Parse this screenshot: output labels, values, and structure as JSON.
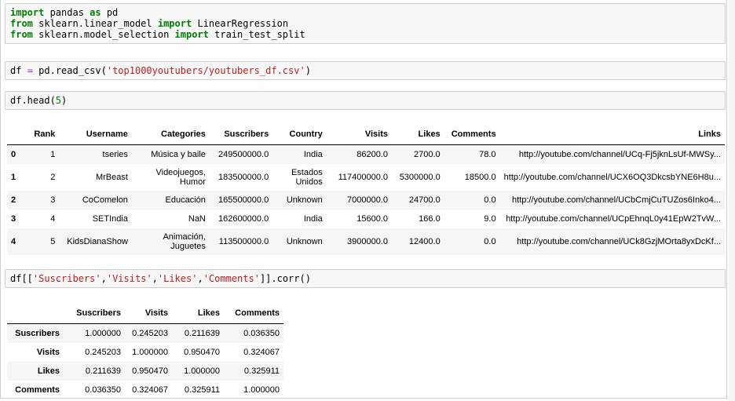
{
  "cells": {
    "c1_l1": {
      "kw1": "import",
      "t1": " pandas ",
      "kw2": "as",
      "t2": " pd"
    },
    "c1_l2": {
      "kw1": "from",
      "t1": " sklearn.linear_model ",
      "kw2": "import",
      "t2": " LinearRegression"
    },
    "c1_l3": {
      "kw1": "from",
      "t1": " sklearn.model_selection ",
      "kw2": "import",
      "t2": " train_test_split"
    },
    "c2": {
      "a": "df ",
      "op": "=",
      "b": " pd.read_csv(",
      "str": "'top1000youtubers/youtubers_df.csv'",
      "c": ")"
    },
    "c3": {
      "a": "df.head(",
      "num": "5",
      "b": ")"
    },
    "c4": {
      "a": "df[[",
      "s1": "'Suscribers'",
      "k1": ",",
      "s2": "'Visits'",
      "k2": ",",
      "s3": "'Likes'",
      "k3": ",",
      "s4": "'Comments'",
      "b": "]].corr()"
    }
  },
  "head_table": {
    "columns": [
      "",
      "Rank",
      "Username",
      "Categories",
      "Suscribers",
      "Country",
      "Visits",
      "Likes",
      "Comments",
      "Links"
    ],
    "rows": [
      [
        "0",
        "1",
        "tseries",
        "Música y baile",
        "249500000.0",
        "India",
        "86200.0",
        "2700.0",
        "78.0",
        "http://youtube.com/channel/UCq-Fj5jknLsUf-MWSy..."
      ],
      [
        "1",
        "2",
        "MrBeast",
        "Videojuegos, Humor",
        "183500000.0",
        "Estados Unidos",
        "117400000.0",
        "5300000.0",
        "18500.0",
        "http://youtube.com/channel/UCX6OQ3DkcsbYNE6H8u..."
      ],
      [
        "2",
        "3",
        "CoComelon",
        "Educación",
        "165500000.0",
        "Unknown",
        "7000000.0",
        "24700.0",
        "0.0",
        "http://youtube.com/channel/UCbCmjCuTUZos6Inko4..."
      ],
      [
        "3",
        "4",
        "SETIndia",
        "NaN",
        "162600000.0",
        "India",
        "15600.0",
        "166.0",
        "9.0",
        "http://youtube.com/channel/UCpEhnqL0y41EpW2TvW..."
      ],
      [
        "4",
        "5",
        "KidsDianaShow",
        "Animación, Juguetes",
        "113500000.0",
        "Unknown",
        "3900000.0",
        "12400.0",
        "0.0",
        "http://youtube.com/channel/UCk8GzjMOrta8yxDcKf..."
      ]
    ]
  },
  "corr_table": {
    "columns": [
      "",
      "Suscribers",
      "Visits",
      "Likes",
      "Comments"
    ],
    "rows": [
      [
        "Suscribers",
        "1.000000",
        "0.245203",
        "0.211639",
        "0.036350"
      ],
      [
        "Visits",
        "0.245203",
        "1.000000",
        "0.950470",
        "0.324067"
      ],
      [
        "Likes",
        "0.211639",
        "0.950470",
        "1.000000",
        "0.325911"
      ],
      [
        "Comments",
        "0.036350",
        "0.324067",
        "0.325911",
        "1.000000"
      ]
    ]
  }
}
